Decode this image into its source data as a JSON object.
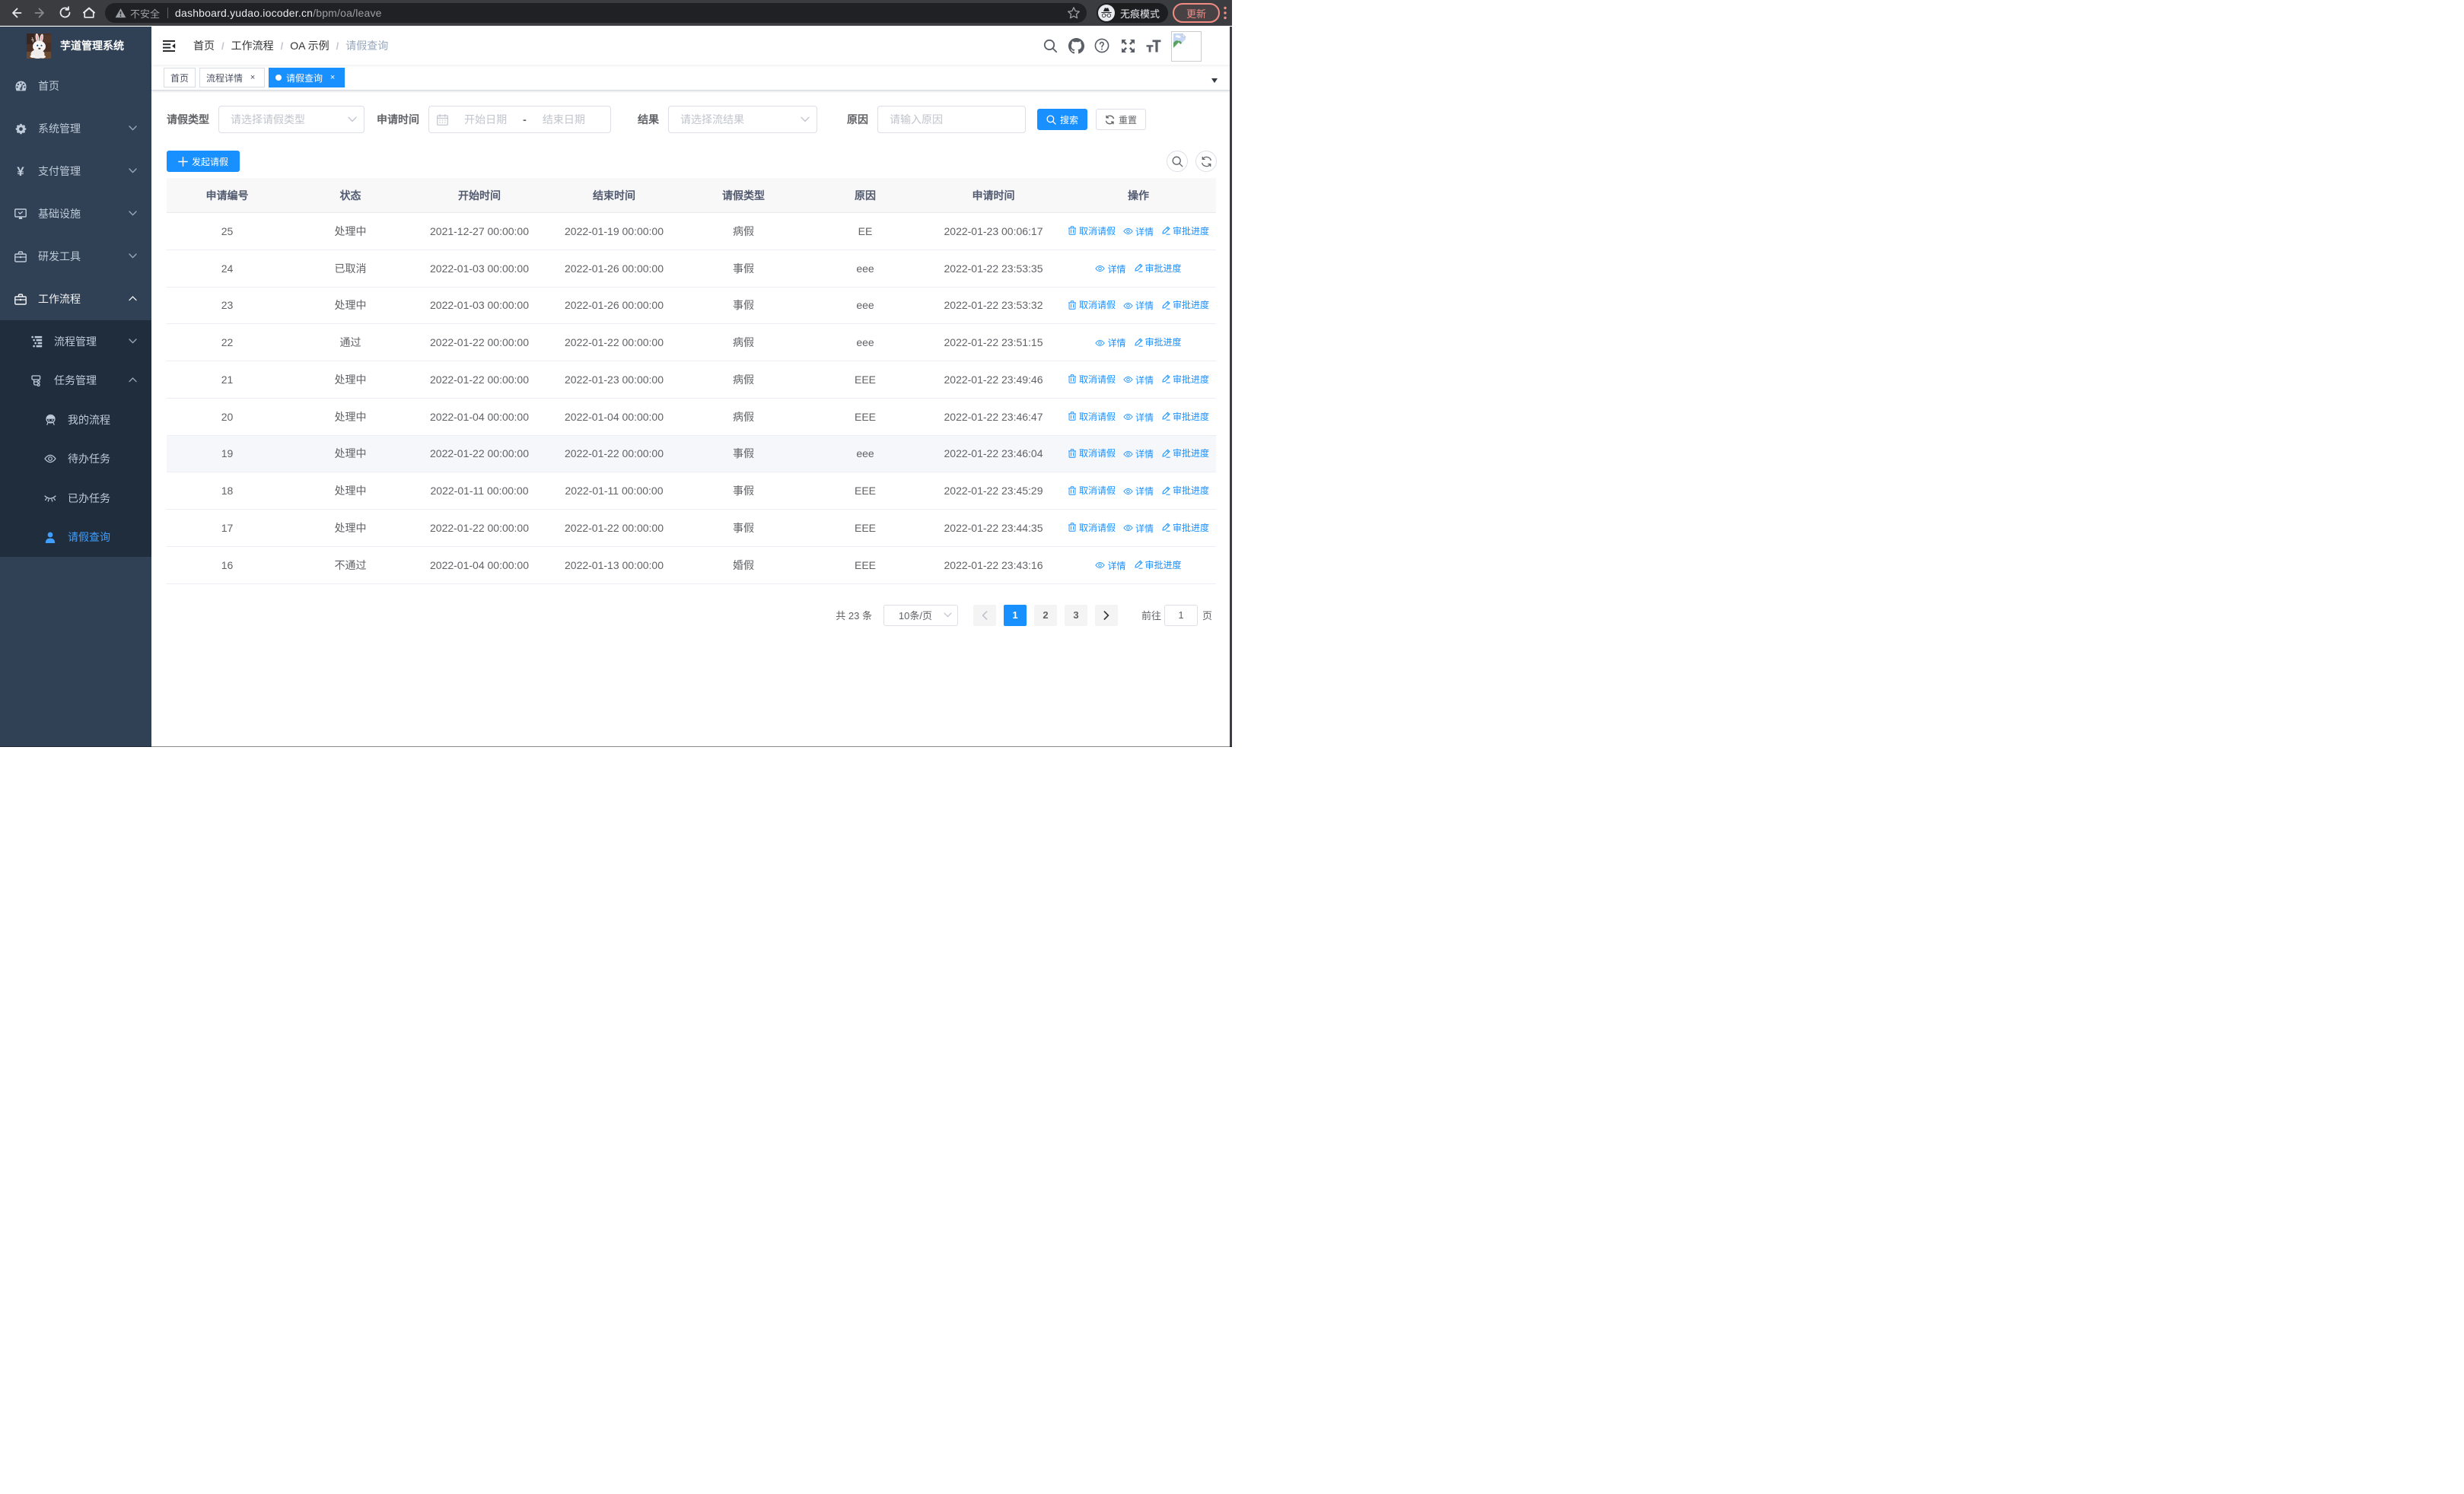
{
  "chrome": {
    "security_label": "不安全",
    "url_host": "dashboard.yudao.iocoder.cn",
    "url_path": "/bpm/oa/leave",
    "incognito_label": "无痕模式",
    "update_label": "更新"
  },
  "sidebar": {
    "title": "芋道管理系统",
    "items": [
      {
        "label": "首页",
        "icon": "dashboard-icon",
        "level": 1
      },
      {
        "label": "系统管理",
        "icon": "gear-icon",
        "level": 1,
        "arrow": "down"
      },
      {
        "label": "支付管理",
        "icon": "yen-icon",
        "level": 1,
        "arrow": "down"
      },
      {
        "label": "基础设施",
        "icon": "monitor-icon",
        "level": 1,
        "arrow": "down"
      },
      {
        "label": "研发工具",
        "icon": "toolbox-icon",
        "level": 1,
        "arrow": "down"
      },
      {
        "label": "工作流程",
        "icon": "briefcase-icon",
        "level": 1,
        "arrow": "up",
        "active_parent": true
      },
      {
        "label": "流程管理",
        "icon": "tree-table-icon",
        "level": 2,
        "arrow": "down"
      },
      {
        "label": "任务管理",
        "icon": "tree-icon",
        "level": 2,
        "arrow": "up"
      },
      {
        "label": "我的流程",
        "icon": "people-icon",
        "level": 3
      },
      {
        "label": "待办任务",
        "icon": "eye-open-icon",
        "level": 3
      },
      {
        "label": "已办任务",
        "icon": "eye-closed-icon",
        "level": 3
      },
      {
        "label": "请假查询",
        "icon": "user-icon",
        "level": 3,
        "active": true
      }
    ]
  },
  "breadcrumb": [
    "首页",
    "工作流程",
    "OA 示例",
    "请假查询"
  ],
  "tags": [
    {
      "label": "首页",
      "closable": false,
      "active": false
    },
    {
      "label": "流程详情",
      "closable": true,
      "active": false
    },
    {
      "label": "请假查询",
      "closable": true,
      "active": true
    }
  ],
  "filter": {
    "leave_type_label": "请假类型",
    "leave_type_placeholder": "请选择请假类型",
    "apply_time_label": "申请时间",
    "start_placeholder": "开始日期",
    "range_separator": "-",
    "end_placeholder": "结束日期",
    "result_label": "结果",
    "result_placeholder": "请选择流结果",
    "reason_label": "原因",
    "reason_placeholder": "请输入原因",
    "search_label": "搜索",
    "reset_label": "重置"
  },
  "toolbar": {
    "create_label": "发起请假"
  },
  "table": {
    "headers": [
      "申请编号",
      "状态",
      "开始时间",
      "结束时间",
      "请假类型",
      "原因",
      "申请时间",
      "操作"
    ],
    "op_labels": {
      "cancel": "取消请假",
      "detail": "详情",
      "progress": "审批进度"
    },
    "rows": [
      {
        "cells": [
          "25",
          "处理中",
          "2021-12-27 00:00:00",
          "2022-01-19 00:00:00",
          "病假",
          "EE",
          "2022-01-23 00:06:17"
        ],
        "ops": [
          "cancel",
          "detail",
          "progress"
        ],
        "hover": false
      },
      {
        "cells": [
          "24",
          "已取消",
          "2022-01-03 00:00:00",
          "2022-01-26 00:00:00",
          "事假",
          "eee",
          "2022-01-22 23:53:35"
        ],
        "ops": [
          "detail",
          "progress"
        ],
        "hover": false
      },
      {
        "cells": [
          "23",
          "处理中",
          "2022-01-03 00:00:00",
          "2022-01-26 00:00:00",
          "事假",
          "eee",
          "2022-01-22 23:53:32"
        ],
        "ops": [
          "cancel",
          "detail",
          "progress"
        ],
        "hover": false
      },
      {
        "cells": [
          "22",
          "通过",
          "2022-01-22 00:00:00",
          "2022-01-22 00:00:00",
          "病假",
          "eee",
          "2022-01-22 23:51:15"
        ],
        "ops": [
          "detail",
          "progress"
        ],
        "hover": false
      },
      {
        "cells": [
          "21",
          "处理中",
          "2022-01-22 00:00:00",
          "2022-01-23 00:00:00",
          "病假",
          "EEE",
          "2022-01-22 23:49:46"
        ],
        "ops": [
          "cancel",
          "detail",
          "progress"
        ],
        "hover": false
      },
      {
        "cells": [
          "20",
          "处理中",
          "2022-01-04 00:00:00",
          "2022-01-04 00:00:00",
          "病假",
          "EEE",
          "2022-01-22 23:46:47"
        ],
        "ops": [
          "cancel",
          "detail",
          "progress"
        ],
        "hover": false
      },
      {
        "cells": [
          "19",
          "处理中",
          "2022-01-22 00:00:00",
          "2022-01-22 00:00:00",
          "事假",
          "eee",
          "2022-01-22 23:46:04"
        ],
        "ops": [
          "cancel",
          "detail",
          "progress"
        ],
        "hover": true
      },
      {
        "cells": [
          "18",
          "处理中",
          "2022-01-11 00:00:00",
          "2022-01-11 00:00:00",
          "事假",
          "EEE",
          "2022-01-22 23:45:29"
        ],
        "ops": [
          "cancel",
          "detail",
          "progress"
        ],
        "hover": false
      },
      {
        "cells": [
          "17",
          "处理中",
          "2022-01-22 00:00:00",
          "2022-01-22 00:00:00",
          "事假",
          "EEE",
          "2022-01-22 23:44:35"
        ],
        "ops": [
          "cancel",
          "detail",
          "progress"
        ],
        "hover": false
      },
      {
        "cells": [
          "16",
          "不通过",
          "2022-01-04 00:00:00",
          "2022-01-13 00:00:00",
          "婚假",
          "EEE",
          "2022-01-22 23:43:16"
        ],
        "ops": [
          "detail",
          "progress"
        ],
        "hover": false
      }
    ]
  },
  "pagination": {
    "total_label": "共 23 条",
    "page_size": "10条/页",
    "pages": [
      "1",
      "2",
      "3"
    ],
    "active_page": "1",
    "jump_prefix": "前往",
    "jump_value": "1",
    "jump_suffix": "页"
  },
  "colors": {
    "primary": "#1890ff",
    "sidebar_bg": "#304156",
    "submenu_bg": "#1f2d3d",
    "menu_text": "#bfcbd9",
    "menu_active_text": "#409eff",
    "update_accent": "#f28b82"
  }
}
